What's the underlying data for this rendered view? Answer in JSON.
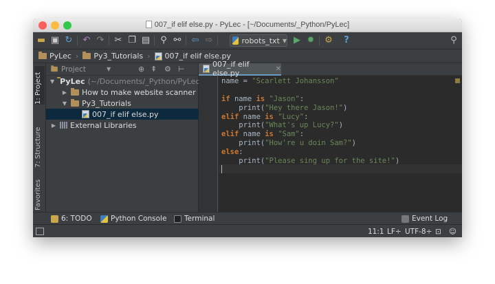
{
  "window": {
    "title": "007_if elif else.py - PyLec - [~/Documents/_Python/PyLec]"
  },
  "colors": {
    "close": "#fc605c",
    "minimize": "#fdbc40",
    "zoom": "#34c84a",
    "accent": "#6c9bc2",
    "keyword": "#cc7832",
    "string": "#6a8759",
    "text": "#a9b7c6"
  },
  "toolbar": {
    "icons": [
      "open-folder-icon",
      "save-icon",
      "sync-icon",
      "undo-icon",
      "redo-icon",
      "cut-icon",
      "copy-icon",
      "paste-icon",
      "find-icon",
      "replace-icon",
      "back-icon",
      "forward-icon",
      "run-icon",
      "debug-icon",
      "settings-icon",
      "help-icon",
      "search-icon"
    ],
    "run_config": "robots_txt"
  },
  "breadcrumb": {
    "items": [
      "PyLec",
      "Py3_Tutorials",
      "007_if elif else.py"
    ]
  },
  "side_tabs": {
    "project": "1: Project",
    "structure": "7: Structure",
    "favorites": "Favorites"
  },
  "project_panel": {
    "header": "Project",
    "tree": [
      {
        "label": "PyLec",
        "path": "(~/Documents/_Python/PyLec)",
        "expanded": true
      },
      {
        "label": "How to make website scanner",
        "expanded": false
      },
      {
        "label": "Py3_Tutorials",
        "expanded": true
      },
      {
        "label": "007_if elif else.py"
      },
      {
        "label": "External Libraries",
        "expanded": false
      }
    ]
  },
  "editor": {
    "tab_label": "007_if elif else.py",
    "lines": [
      [
        {
          "t": "name = ",
          "c": "fn"
        },
        {
          "t": "\"Scarlett Johansson\"",
          "c": "st"
        }
      ],
      [],
      [
        {
          "t": "if ",
          "c": "kw"
        },
        {
          "t": "name ",
          "c": "fn"
        },
        {
          "t": "is ",
          "c": "kw"
        },
        {
          "t": "\"Jason\"",
          "c": "st"
        },
        {
          "t": ":",
          "c": "fn"
        }
      ],
      [
        {
          "t": "    print(",
          "c": "fn"
        },
        {
          "t": "\"Hey there Jason!\"",
          "c": "st"
        },
        {
          "t": ")",
          "c": "fn"
        }
      ],
      [
        {
          "t": "elif ",
          "c": "kw"
        },
        {
          "t": "name ",
          "c": "fn"
        },
        {
          "t": "is ",
          "c": "kw"
        },
        {
          "t": "\"Lucy\"",
          "c": "st"
        },
        {
          "t": ":",
          "c": "fn"
        }
      ],
      [
        {
          "t": "    print(",
          "c": "fn"
        },
        {
          "t": "\"What's up Lucy?\"",
          "c": "st"
        },
        {
          "t": ")",
          "c": "fn"
        }
      ],
      [
        {
          "t": "elif ",
          "c": "kw"
        },
        {
          "t": "name ",
          "c": "fn"
        },
        {
          "t": "is ",
          "c": "kw"
        },
        {
          "t": "\"Sam\"",
          "c": "st"
        },
        {
          "t": ":",
          "c": "fn"
        }
      ],
      [
        {
          "t": "    print(",
          "c": "fn"
        },
        {
          "t": "\"How're u doin Sam?\"",
          "c": "st"
        },
        {
          "t": ")",
          "c": "fn"
        }
      ],
      [
        {
          "t": "else",
          "c": "kw"
        },
        {
          "t": ":",
          "c": "fn"
        }
      ],
      [
        {
          "t": "    print(",
          "c": "fn"
        },
        {
          "t": "\"Please sing up for the site!\"",
          "c": "st"
        },
        {
          "t": ")",
          "c": "fn"
        }
      ],
      []
    ]
  },
  "bottom_tools": {
    "todo": "6: TODO",
    "console": "Python Console",
    "terminal": "Terminal",
    "event_log": "Event Log"
  },
  "status": {
    "position": "11:1",
    "line_sep": "LF÷",
    "encoding": "UTF-8÷"
  }
}
